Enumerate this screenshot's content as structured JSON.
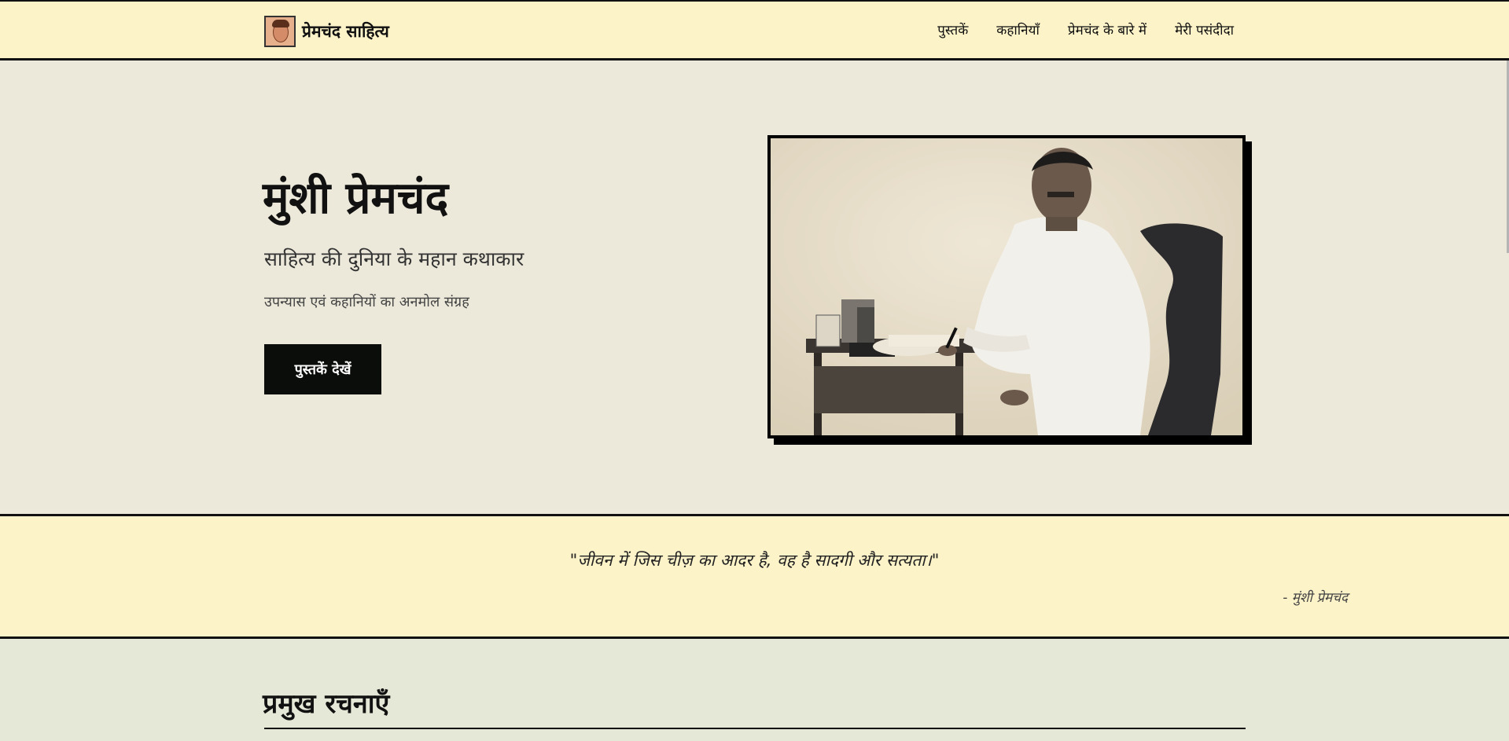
{
  "nav": {
    "brand": "प्रेमचंद साहित्य",
    "links": [
      "पुस्तकें",
      "कहानियाँ",
      "प्रेमचंद के बारे में",
      "मेरी पसंदीदा"
    ]
  },
  "hero": {
    "title": "मुंशी प्रेमचंद",
    "subtitle": "साहित्य की दुनिया के महान कथाकार",
    "description": "उपन्यास एवं कहानियों का अनमोल संग्रह",
    "cta": "पुस्तकें देखें"
  },
  "quote": {
    "text": "\"जीवन में जिस चीज़ का आदर है, वह है सादगी और सत्यता।\"",
    "author": "- मुंशी प्रेमचंद"
  },
  "works": {
    "title": "प्रमुख रचनाएँ"
  },
  "colors": {
    "nav_bg": "#fdf3c9",
    "hero_bg": "#ece9da",
    "button_bg": "#0a0d09",
    "works_bg": "#e5e8d6"
  }
}
